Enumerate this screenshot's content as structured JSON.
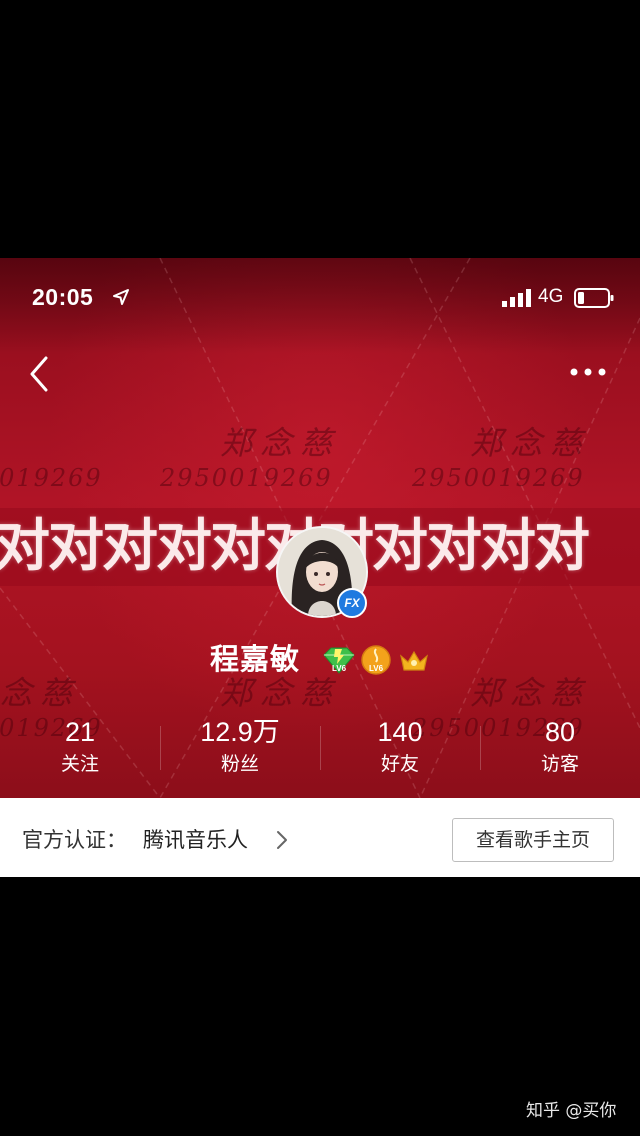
{
  "status_bar": {
    "time": "20:05",
    "network": "4G"
  },
  "background": {
    "watermark_name": "郑念慈",
    "watermark_number": "2950019269",
    "banner_text": "对对对对对对对对对对对"
  },
  "profile": {
    "nickname": "程嘉敏",
    "avatar_badge": "FX",
    "level_badge_1": "LV6",
    "level_badge_2": "LV6"
  },
  "stats": [
    {
      "value": "21",
      "label": "关注"
    },
    {
      "value": "12.9万",
      "label": "粉丝"
    },
    {
      "value": "140",
      "label": "好友"
    },
    {
      "value": "80",
      "label": "访客"
    }
  ],
  "certification": {
    "label": "官方认证：",
    "value": "腾讯音乐人",
    "button": "查看歌手主页"
  },
  "footer": {
    "watermark": "知乎 @买你"
  },
  "colors": {
    "header_red": "#b01426",
    "badge_blue": "#1f7ae0",
    "green_diamond": "#3fbf4a",
    "orange_badge": "#f3a21b"
  }
}
